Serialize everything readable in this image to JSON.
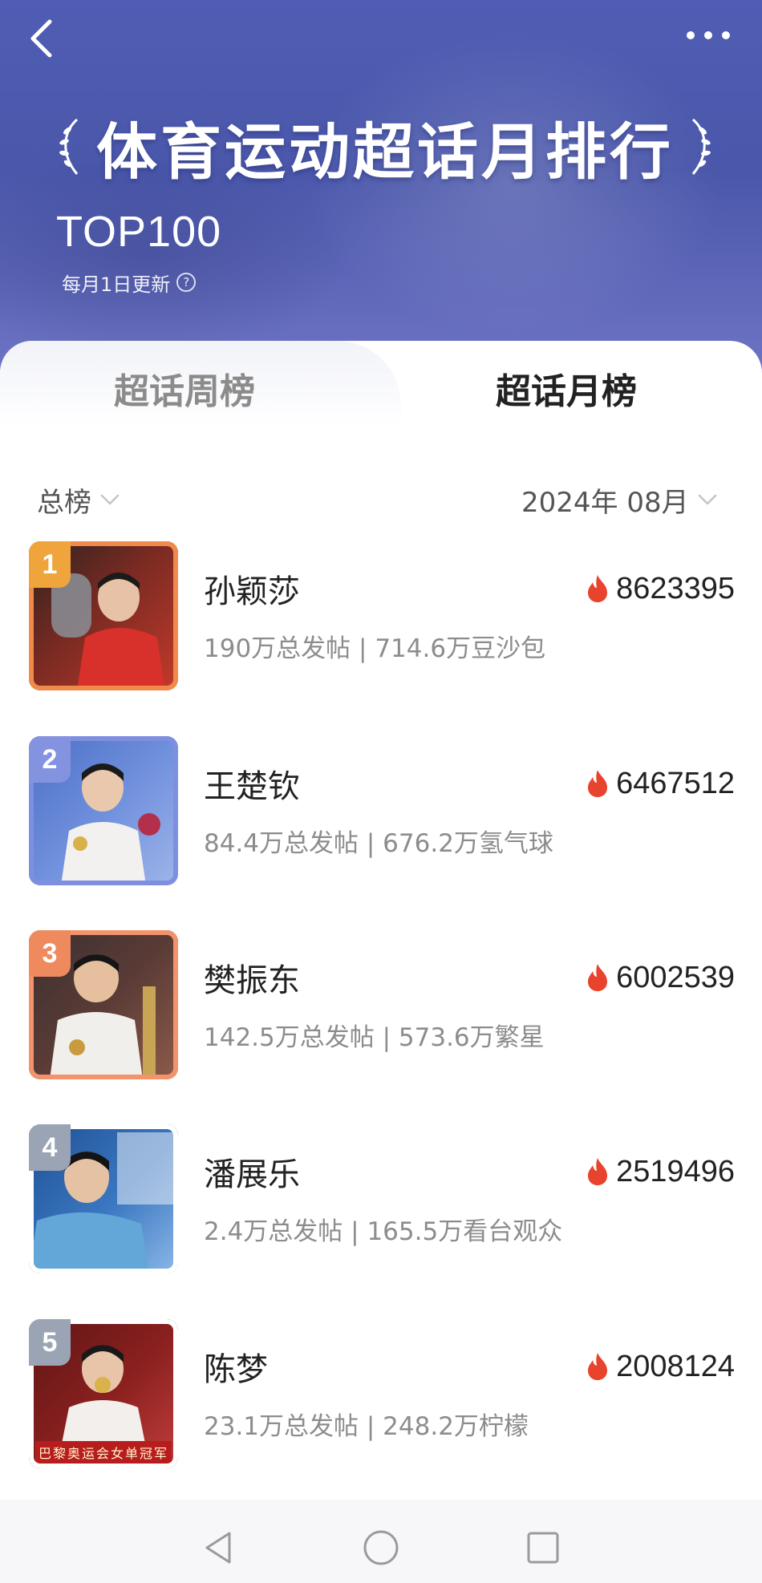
{
  "header": {
    "title": "体育运动超话月排行",
    "top_label": "TOP100",
    "update_note": "每月1日更新",
    "help_icon": "question-circle-icon",
    "colors": {
      "bg_top": "#4f5db4",
      "bg_bottom": "#6e74c4"
    }
  },
  "tabs": [
    {
      "label": "超话周榜",
      "active": false
    },
    {
      "label": "超话月榜",
      "active": true
    }
  ],
  "filters": {
    "category": "总榜",
    "period": "2024年 08月"
  },
  "ranking": [
    {
      "rank": "1",
      "name": "孙颖莎",
      "stats": "190万总发帖 | 714.6万豆沙包",
      "score": "8623395",
      "frame_color": "#f08a4b",
      "badge_color": "#f0a53c"
    },
    {
      "rank": "2",
      "name": "王楚钦",
      "stats": "84.4万总发帖 | 676.2万氢气球",
      "score": "6467512",
      "frame_color": "#7f8fe0",
      "badge_color": "#8493e0"
    },
    {
      "rank": "3",
      "name": "樊振东",
      "stats": "142.5万总发帖 | 573.6万繁星",
      "score": "6002539",
      "frame_color": "#f2936b",
      "badge_color": "#ef8a5f"
    },
    {
      "rank": "4",
      "name": "潘展乐",
      "stats": "2.4万总发帖 | 165.5万看台观众",
      "score": "2519496",
      "frame_color": "#ffffff",
      "badge_color": "#9aa4b4"
    },
    {
      "rank": "5",
      "name": "陈梦",
      "stats": "23.1万总发帖 | 248.2万柠檬",
      "score": "2008124",
      "frame_color": "#ffffff",
      "badge_color": "#9aa4b4",
      "caption": "巴黎奥运会女单冠军"
    }
  ],
  "nav": {
    "back": "triangle-back-icon",
    "home": "circle-home-icon",
    "recent": "square-recents-icon"
  },
  "accent_color": "#e8432d"
}
